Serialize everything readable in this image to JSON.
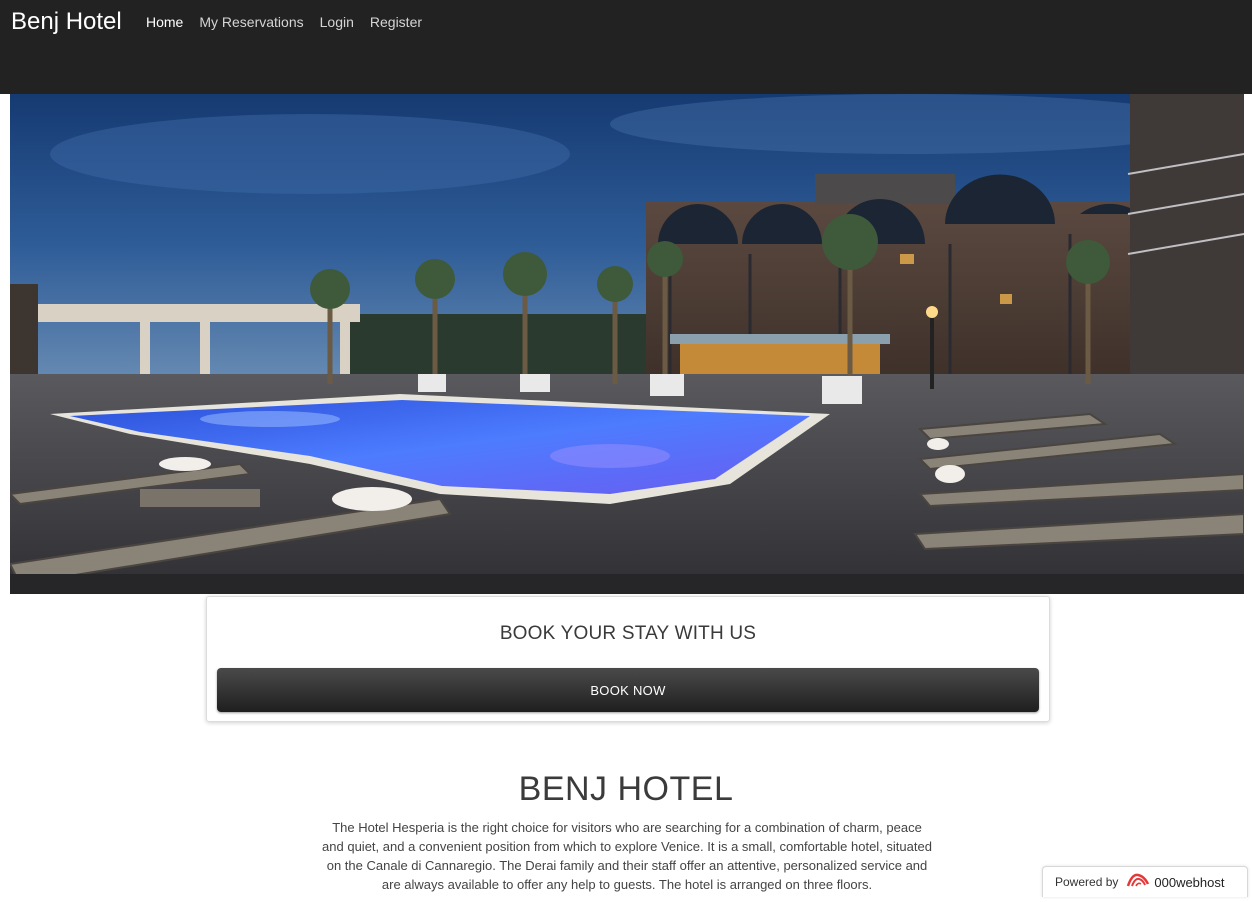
{
  "nav": {
    "brand": "Benj Hotel",
    "links": [
      {
        "label": "Home",
        "active": true
      },
      {
        "label": "My Reservations",
        "active": false
      },
      {
        "label": "Login",
        "active": false
      },
      {
        "label": "Register",
        "active": false
      }
    ]
  },
  "booking": {
    "title": "BOOK YOUR STAY WITH US",
    "button_label": "BOOK NOW"
  },
  "about": {
    "title": "BENJ HOTEL",
    "text": "The Hotel Hesperia is the right choice for visitors who are searching for a combination of charm, peace and quiet, and a convenient position from which to explore Venice. It is a small, comfortable hotel, situated on the Canale di Cannaregio. The Derai family and their staff offer an attentive, personalized service and are always available to offer any help to guests. The hotel is arranged on three floors."
  },
  "footer_badge": {
    "powered_by": "Powered by",
    "host": "000webhost",
    "icon": "000webhost-logo-icon"
  },
  "colors": {
    "navbar": "#222222",
    "button_top": "#4a4a4a",
    "button_bottom": "#1f1f1f",
    "pool": "#3f6cf0",
    "sky": "#1f4a86"
  }
}
